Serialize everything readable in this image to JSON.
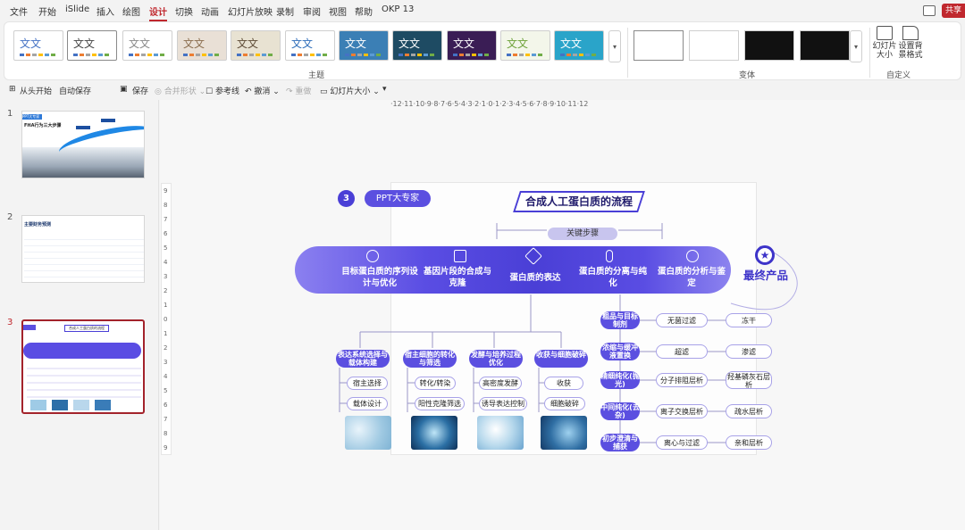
{
  "menubar": {
    "items": [
      "文件",
      "开始",
      "iSlide",
      "插入",
      "绘图",
      "设计",
      "切换",
      "动画",
      "幻灯片放映",
      "录制",
      "审阅",
      "视图",
      "帮助",
      "OKP 13"
    ],
    "active_index": 5,
    "share": "共享"
  },
  "ribbon": {
    "themes_label": "主题",
    "variants_label": "变体",
    "customize_label": "自定义",
    "theme_sample": "文文",
    "slide_size": "幻灯片大小",
    "bg_format": "设置背景格式",
    "theme_colors": [
      [
        "#fff",
        "#4472c4"
      ],
      [
        "#fff",
        "#444"
      ],
      [
        "#fff",
        "#888"
      ],
      [
        "#e9e0d6",
        "#8b6e4f"
      ],
      [
        "#e8e2d2",
        "#5e4b36"
      ],
      [
        "#fff",
        "#2f6eba"
      ],
      [
        "#3b7fb5",
        "#fff"
      ],
      [
        "#1e4b63",
        "#fff"
      ],
      [
        "#3a1d55",
        "#fff"
      ],
      [
        "#f3f6ea",
        "#6ea23a"
      ],
      [
        "#2aa4c9",
        "#fff"
      ]
    ]
  },
  "qat": {
    "from_start": "从头开始",
    "autosave": "自动保存",
    "autosave_state": "关",
    "save": "保存",
    "merge_shapes": "合并形状",
    "guides": "参考线",
    "undo": "撤消",
    "redo": "重做",
    "slide_size": "幻灯片大小"
  },
  "thumbs": {
    "n1": "1",
    "n2": "2",
    "n3": "3",
    "t1_tag": "PPT大专家",
    "t1_title": "FHA行为三大步骤",
    "t2_title": "主要财务预测",
    "t3_title": "合成人工蛋白质的流程"
  },
  "ruler": {
    "h": "·12·11·10·9·8·7·6·5·4·3·2·1·0·1·2·3·4·5·6·7·8·9·10·11·12",
    "v": [
      "9",
      "8",
      "7",
      "6",
      "5",
      "4",
      "3",
      "2",
      "1",
      "0",
      "1",
      "2",
      "3",
      "4",
      "5",
      "6",
      "7",
      "8",
      "9"
    ]
  },
  "slide": {
    "badge": "3",
    "tag": "PPT大专家",
    "title": "合成人工蛋白质的流程",
    "key_steps": "关键步骤",
    "steps": [
      "目标蛋白质的序列设计与优化",
      "基因片段的合成与克隆",
      "蛋白质的表达",
      "蛋白质的分离与纯化",
      "蛋白质的分析与鉴定"
    ],
    "final": "最终产品",
    "columns": [
      {
        "head": "表达系统选择与载体构建",
        "items": [
          "宿主选择",
          "载体设计"
        ]
      },
      {
        "head": "宿主细胞的转化与筛选",
        "items": [
          "转化/转染",
          "阳性克隆筛选"
        ]
      },
      {
        "head": "发酵与培养过程优化",
        "items": [
          "高密度发酵",
          "诱导表达控制"
        ]
      },
      {
        "head": "收获与细胞破碎",
        "items": [
          "收获",
          "细胞破碎"
        ]
      }
    ],
    "purify": [
      {
        "head": "粗品与目标制剂",
        "a": "无菌过滤",
        "b": "冻干"
      },
      {
        "head": "浓缩与缓冲液置换",
        "a": "超滤",
        "b": "渗滤"
      },
      {
        "head": "精细纯化(抛光)",
        "a": "分子排阻层析",
        "b": "羟基磷灰石层析"
      },
      {
        "head": "中间纯化(去杂)",
        "a": "离子交换层析",
        "b": "疏水层析"
      },
      {
        "head": "初步澄清与捕获",
        "a": "离心与过滤",
        "b": "亲和层析"
      }
    ]
  },
  "colors": {
    "accent": "#4a3fd6",
    "brand_red": "#c0282e"
  }
}
